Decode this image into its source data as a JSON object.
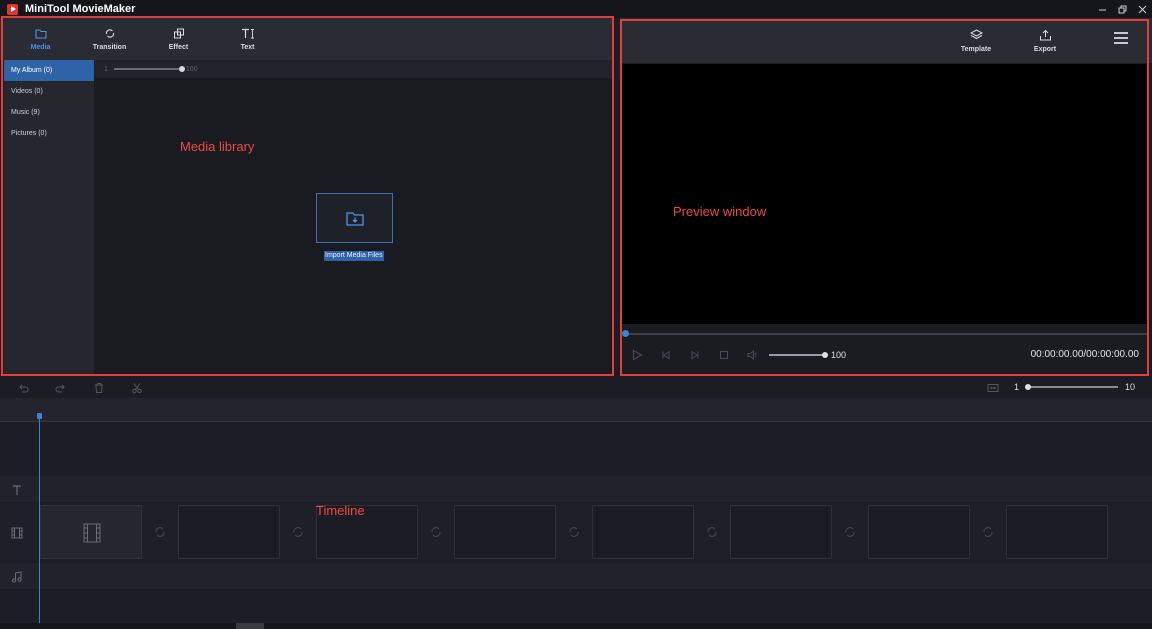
{
  "window": {
    "title": "MiniTool MovieMaker"
  },
  "toolbar": {
    "media_label": "Media",
    "transition_label": "Transition",
    "effect_label": "Effect",
    "text_label": "Text"
  },
  "sidebar": {
    "items": [
      {
        "label": "My Album  (0)"
      },
      {
        "label": "Videos  (0)"
      },
      {
        "label": "Music  (9)"
      },
      {
        "label": "Pictures  (0)"
      }
    ]
  },
  "media": {
    "zoom_min": "1",
    "zoom_max": "100",
    "import_label": "Import Media Files"
  },
  "right_toolbar": {
    "template_label": "Template",
    "export_label": "Export"
  },
  "player": {
    "volume": "100",
    "timecode": "00:00:00.00/00:00:00.00"
  },
  "timeline": {
    "zoom_min": "1",
    "zoom_max": "10",
    "clip_slots": 8
  },
  "annotations": {
    "media_library": "Media library",
    "preview_window": "Preview window",
    "timeline": "Timeline"
  },
  "colors": {
    "accent": "#3b82d8",
    "annotation": "#e0403c",
    "selected": "#2f63a8"
  }
}
